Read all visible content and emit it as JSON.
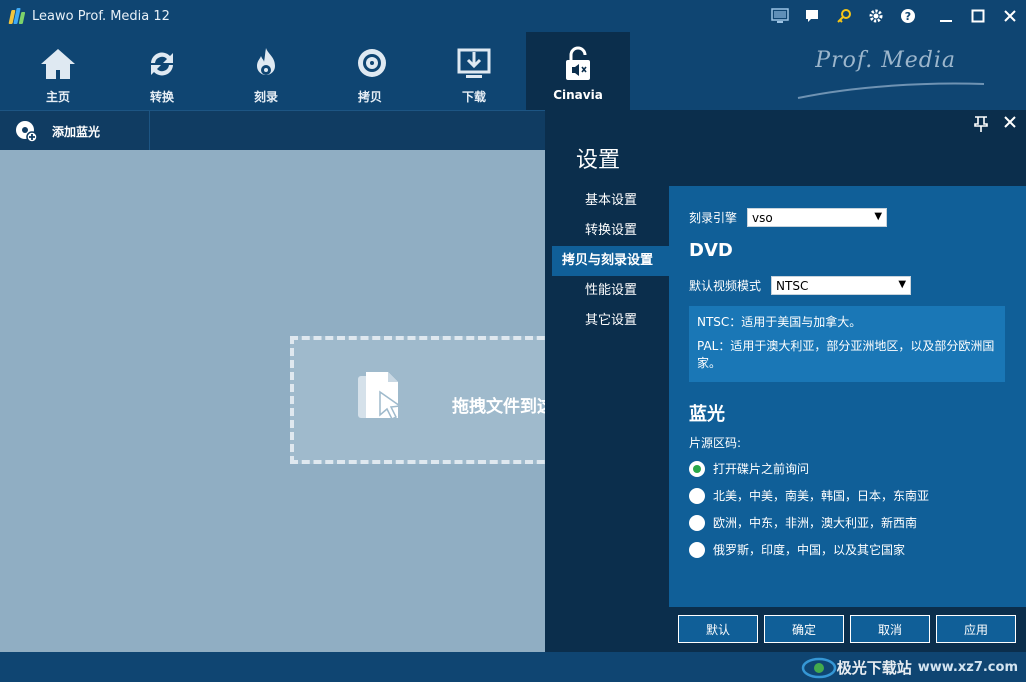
{
  "titlebar": {
    "app_title": "Leawo Prof. Media 12",
    "icons": [
      "screen-icon",
      "chat-icon",
      "key-icon",
      "gear-icon",
      "help-icon",
      "minimize-icon",
      "maximize-icon",
      "close-icon"
    ]
  },
  "nav": {
    "items": [
      {
        "label": "主页",
        "icon": "home-icon"
      },
      {
        "label": "转换",
        "icon": "convert-icon"
      },
      {
        "label": "刻录",
        "icon": "burn-icon"
      },
      {
        "label": "拷贝",
        "icon": "copy-disc-icon"
      },
      {
        "label": "下载",
        "icon": "download-icon"
      },
      {
        "label": "Cinavia",
        "icon": "cinavia-lock-icon"
      }
    ],
    "active": "Cinavia",
    "brand": "Prof. Media"
  },
  "toolbar": {
    "add_bluray_label": "添加蓝光"
  },
  "content": {
    "drop_text": "拖拽文件到这"
  },
  "settings": {
    "title": "设置",
    "menu": [
      "基本设置",
      "转换设置",
      "拷贝与刻录设置",
      "性能设置",
      "其它设置"
    ],
    "active_menu": "拷贝与刻录设置",
    "burn_engine_label": "刻录引擎",
    "burn_engine_value": "vso",
    "dvd_title": "DVD",
    "video_mode_label": "默认视频模式",
    "video_mode_value": "NTSC",
    "ntsc_info": "NTSC：适用于美国与加拿大。",
    "pal_info": "PAL：适用于澳大利亚，部分亚洲地区，以及部分欧洲国家。",
    "bluray_title": "蓝光",
    "region_label": "片源区码:",
    "region_options": [
      {
        "label": "打开碟片之前询问",
        "checked": true
      },
      {
        "label": "北美，中美，南美，韩国，日本，东南亚",
        "checked": false
      },
      {
        "label": "欧洲，中东，非洲，澳大利亚，新西南",
        "checked": false
      },
      {
        "label": "俄罗斯，印度，中国，以及其它国家",
        "checked": false
      }
    ],
    "buttons": {
      "default": "默认",
      "ok": "确定",
      "cancel": "取消",
      "apply": "应用"
    }
  },
  "watermark": {
    "text": "极光下载站",
    "site": "www.xz7.com"
  },
  "colors": {
    "titlebar_bg": "#0f4572",
    "panel_bg": "#0b2e4c",
    "panel_body": "#105f98",
    "content_bg": "#90aec3",
    "radio_checked": "#29a84a"
  }
}
